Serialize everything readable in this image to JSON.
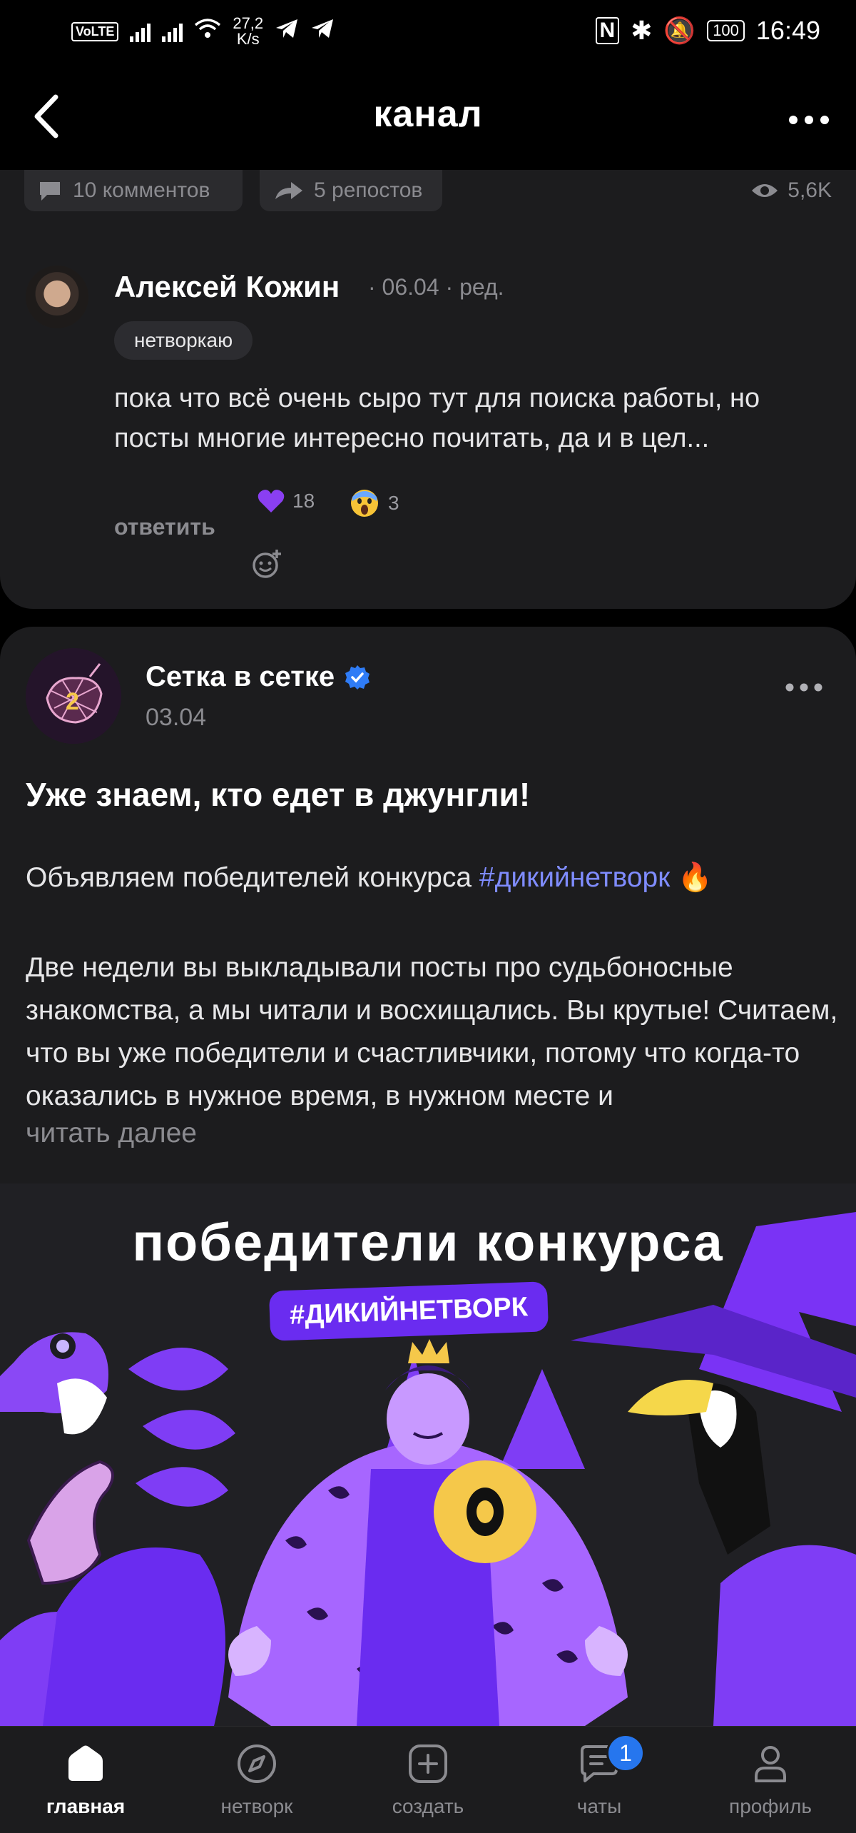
{
  "status_bar": {
    "volte": "VoLTE",
    "speed": "27,2",
    "speed_unit": "K/s",
    "battery": "100",
    "time": "16:49"
  },
  "header": {
    "title": "канал"
  },
  "prev_post_stats": {
    "comments": "10 комментов",
    "reposts": "5 репостов",
    "views": "5,6K"
  },
  "comment": {
    "author": "Алексей Кожин",
    "meta": "· 06.04 · ред.",
    "tag": "нетворкаю",
    "text": "пока что всё очень сыро тут для поиска работы, но посты многие интересно почитать, да и в цел...",
    "reactions": [
      {
        "icon": "purple-heart",
        "count": "18"
      },
      {
        "icon": "screaming-face",
        "count": "3"
      }
    ],
    "reply_label": "ответить"
  },
  "post": {
    "channel": "Сетка в сетке",
    "date": "03.04",
    "title": "Уже знаем, кто едет в джунгли!",
    "lead": "Объявляем победителей конкурса",
    "hashtag": "#дикийнетворк",
    "body": "Две недели вы выкладывали посты про судьбоносные знакомства, а мы читали и восхищались. Вы крутые! Считаем, что вы уже победители и счастливчики, потому что когда-то оказались в нужное время, в нужном месте и",
    "read_more": "читать далее",
    "banner_title": "победители конкурса",
    "banner_tag": "#ДИКИЙНЕТВОРК"
  },
  "nav": {
    "items": [
      {
        "label": "главная",
        "icon": "home-icon"
      },
      {
        "label": "нетворк",
        "icon": "compass-icon"
      },
      {
        "label": "создать",
        "icon": "plus-square-icon"
      },
      {
        "label": "чаты",
        "icon": "chat-icon",
        "badge": "1"
      },
      {
        "label": "профиль",
        "icon": "profile-icon"
      }
    ]
  },
  "colors": {
    "background": "#1c1c1e",
    "accent_purple": "#6a2cf0",
    "hashtag": "#7f8cff",
    "badge": "#2676ee"
  }
}
